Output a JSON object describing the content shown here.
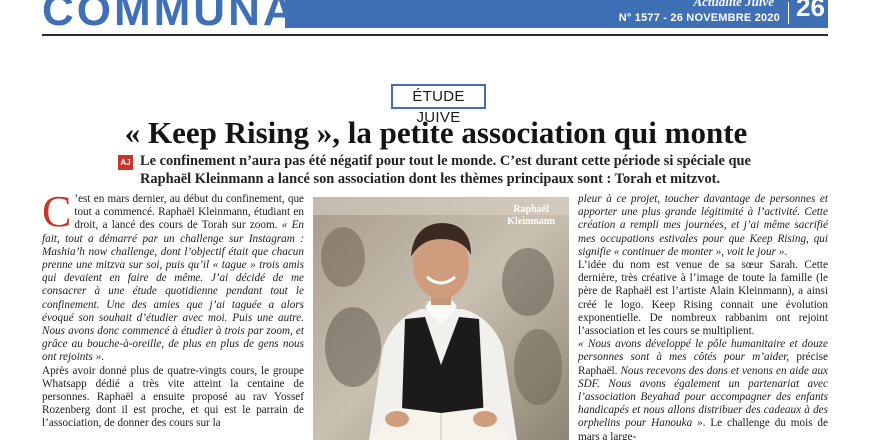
{
  "masthead": {
    "section": "COMMUNAUTÉ",
    "brand": "Actualité Juive",
    "issue": "N° 1577 - 26 NOVEMBRE 2020",
    "page": "26"
  },
  "article": {
    "rubric": "ÉTUDE JUIVE",
    "title": "« Keep Rising », la petite association qui monte",
    "lede_badge": "AJ",
    "lede": "Le confinement n’aura pas été négatif pour tout le monde. C’est durant cette période si spéciale que Raphaël Kleinmann a lancé son association dont les thèmes principaux sont : Torah et mitzvot.",
    "left_column": {
      "dropcap": "C",
      "p1_plain": "’est en mars dernier, au début du confinement, que tout a commencé. Raphaël Kleinmann, étudiant en droit, a lancé des cours de Torah sur zoom. ",
      "p1_quote": "« En fait, tout a démarré par un challenge sur Instagram : Mashia’h now challenge, dont l’objectif était que chacun prenne une mitzva sur soi, puis qu’il « tague » trois amis qui devaient en faire de même. J’ai décidé de me consacrer à une étude quotidienne pendant tout le confinement. Une des amies que j’ai taguée a alors évoqué son souhait d’étudier avec moi. Puis une autre. Nous avons donc commencé à étudier à trois par zoom, et grâce au bouche-à-oreille, de plus en plus de gens nous ont rejoints »",
      "p1_end": ".",
      "p2": "Après avoir donné plus de quatre-vingts cours, le groupe Whatsapp dédié a très vite atteint la centaine de personnes. Raphaël a ensuite proposé au rav Yossef Rozenberg dont il est proche, et qui est le parrain de l’association, de donner des cours sur la"
    },
    "right_column": {
      "p1_quote": "pleur à ce projet, toucher davantage de personnes et apporter une plus grande légitimité à l’activité. Cette création a rempli mes journées, et j’ai même sacrifié mes occupations estivales pour que Keep Rising, qui signifie « continuer de monter », voit le jour »",
      "p1_end": ".",
      "p2": "L’idée du nom est venue de sa sœur Sarah. Cette dernière, très créative à l’image de toute la famille (le père de Raphaël est l’artiste Alain Kleinmann), a ainsi créé le logo. Keep Rising connait une évolution exponentielle. De nombreux rabbanim ont rejoint l’association et les cours se multiplient.",
      "p3_quote": "« Nous avons développé le pôle humanitaire et douze personnes sont à mes côtés pour m’aider,",
      "p3_mid": " précise Raphaël. ",
      "p3_quote2": "Nous recevons des dons et venons en aide aux SDF. Nous avons également un partenariat avec l’association Beyahad pour accompagner des enfants handicapés et nous allons distribuer des cadeaux à des orphelins pour Hanouka »",
      "p3_end": ". Le challenge du mois de mars a large-"
    },
    "photo": {
      "caption_line1": "Raphaël",
      "caption_line2": "Kleinmann"
    }
  },
  "colors": {
    "accent_blue": "#3f6fb5",
    "dropcap_red": "#c8352a"
  }
}
